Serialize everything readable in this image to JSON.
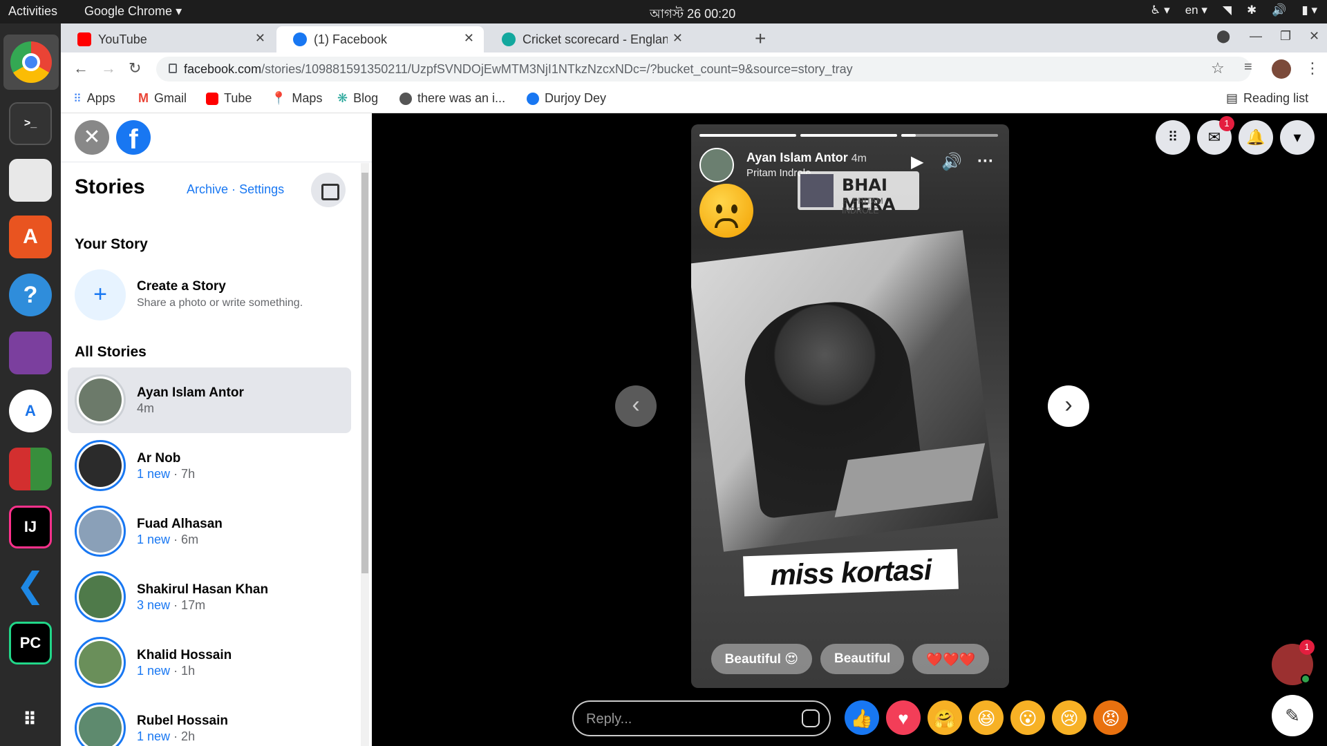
{
  "system": {
    "activities": "Activities",
    "app_name": "Google Chrome",
    "clock": "আগস্ট 26  00:20",
    "lang": "en"
  },
  "tabs": [
    {
      "title": "YouTube",
      "color": "#ff0000"
    },
    {
      "title": "(1) Facebook",
      "color": "#1877f2"
    },
    {
      "title": "Cricket scorecard - Englan",
      "color": "#13a89e"
    }
  ],
  "url": {
    "host": "facebook.com",
    "path": "/stories/109881591350211/UzpfSVNDOjEwMTM3NjI1NTkzNzcxNDc=/?bucket_count=9&source=story_tray"
  },
  "bookmarks": [
    {
      "label": "Apps",
      "color": "#4285f4"
    },
    {
      "label": "Gmail",
      "color": "#ea4335"
    },
    {
      "label": "Tube",
      "color": "#ff0000"
    },
    {
      "label": "Maps",
      "color": "#34a853"
    },
    {
      "label": "Blog",
      "color": "#26a69a"
    },
    {
      "label": "there was an i...",
      "color": "#555555"
    },
    {
      "label": "Durjoy Dey",
      "color": "#1877f2"
    }
  ],
  "reading_list": "Reading list",
  "sidebar": {
    "title": "Stories",
    "archive": "Archive",
    "sep": "·",
    "settings": "Settings",
    "your_story": "Your Story",
    "create_title": "Create a Story",
    "create_sub": "Share a photo or write something.",
    "all_stories": "All Stories",
    "stories": [
      {
        "name": "Ayan Islam Antor",
        "new": "",
        "time": "4m",
        "seen": true
      },
      {
        "name": "Ar Nob",
        "new": "1 new",
        "time": "· 7h",
        "seen": false
      },
      {
        "name": "Fuad Alhasan",
        "new": "1 new",
        "time": "· 6m",
        "seen": false
      },
      {
        "name": "Shakirul Hasan Khan",
        "new": "3 new",
        "time": "· 17m",
        "seen": false
      },
      {
        "name": "Khalid Hossain",
        "new": "1 new",
        "time": "· 1h",
        "seen": false
      },
      {
        "name": "Rubel Hossain",
        "new": "1 new",
        "time": "· 2h",
        "seen": false
      }
    ]
  },
  "story": {
    "author": "Ayan Islam Antor",
    "time": "4m",
    "music": "Pritam Indrole",
    "sticker_title": "BHAI MERA",
    "sticker_artist": "♬ PRITAM INDROLE",
    "caption": "miss kortasi",
    "quick_replies": [
      "Beautiful 😍",
      "Beautiful",
      "❤️❤️❤️"
    ],
    "progress": [
      1,
      1,
      0.15
    ]
  },
  "reply_placeholder": "Reply...",
  "messenger_badge": "1",
  "chat_badge": "1"
}
